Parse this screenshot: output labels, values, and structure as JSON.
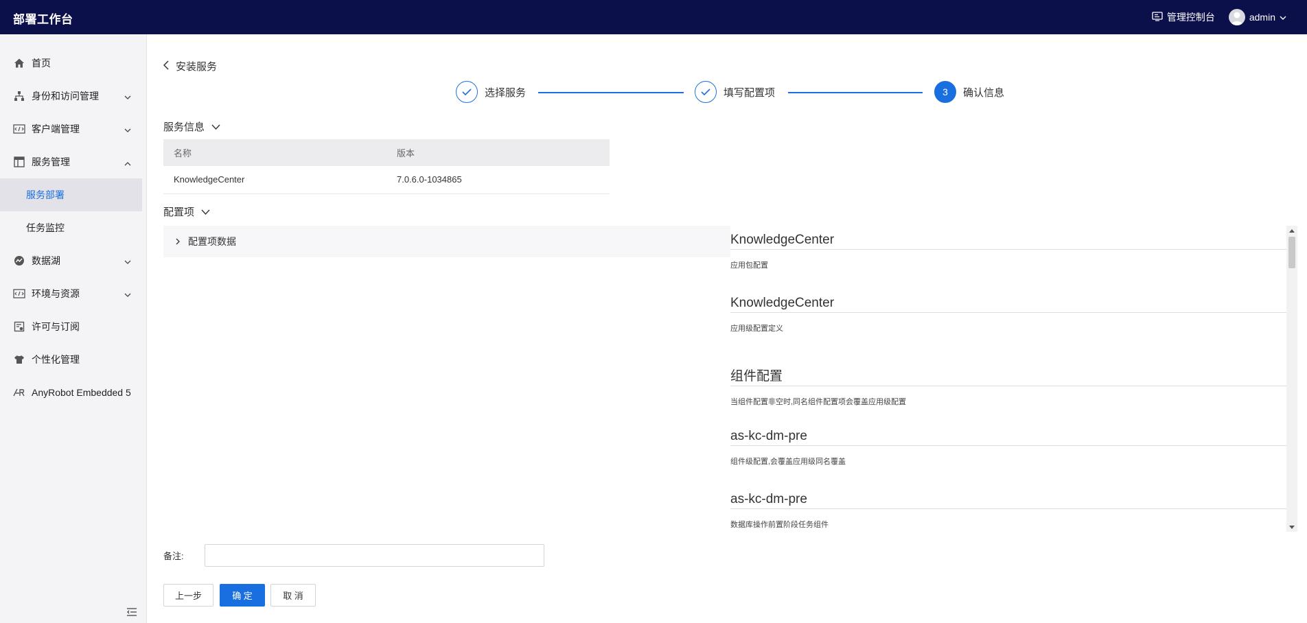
{
  "header": {
    "app_title": "部署工作台",
    "console_label": "管理控制台",
    "username": "admin"
  },
  "sidebar": {
    "items": [
      {
        "label": "首页",
        "icon": "home-icon"
      },
      {
        "label": "身份和访问管理",
        "icon": "org-tree-icon",
        "expanded": false
      },
      {
        "label": "客户端管理",
        "icon": "code-window-icon",
        "expanded": false
      },
      {
        "label": "服务管理",
        "icon": "table-icon",
        "expanded": true
      },
      {
        "label": "服务部署",
        "sub": true,
        "active": true
      },
      {
        "label": "任务监控",
        "sub": true
      },
      {
        "label": "数据湖",
        "icon": "data-lake-icon",
        "expanded": false
      },
      {
        "label": "环境与资源",
        "icon": "code-window-icon",
        "expanded": false
      },
      {
        "label": "许可与订阅",
        "icon": "license-icon"
      },
      {
        "label": "个性化管理",
        "icon": "shirt-icon"
      },
      {
        "label": "AnyRobot Embedded 5",
        "icon": "anyrobot-icon"
      }
    ]
  },
  "page": {
    "back_label": "安装服务",
    "steps": [
      {
        "label": "选择服务",
        "status": "done"
      },
      {
        "label": "填写配置项",
        "status": "done"
      },
      {
        "label": "确认信息",
        "status": "current",
        "number": "3"
      }
    ]
  },
  "service_info": {
    "title": "服务信息",
    "columns": [
      "名称",
      "版本"
    ],
    "rows": [
      [
        "KnowledgeCenter",
        "7.0.6.0-1034865"
      ]
    ]
  },
  "config": {
    "title": "配置项",
    "collapse_label": "配置项数据",
    "entries": [
      {
        "title": "KnowledgeCenter",
        "desc": "应用包配置"
      },
      {
        "title": "KnowledgeCenter",
        "desc": "应用级配置定义"
      },
      {
        "title": "组件配置",
        "desc": "当组件配置非空时,同名组件配置项会覆盖应用级配置"
      },
      {
        "title": "as-kc-dm-pre",
        "desc": "组件级配置,会覆盖应用级同名覆盖"
      },
      {
        "title": "as-kc-dm-pre",
        "desc": "数据库操作前置阶段任务组件"
      }
    ]
  },
  "form": {
    "remark_label": "备注:",
    "remark_value": ""
  },
  "buttons": {
    "prev": "上一步",
    "confirm": "确 定",
    "cancel": "取 消"
  },
  "colors": {
    "topbar": "#0b0f4a",
    "accent": "#1a6fe0",
    "sidebar_bg": "#f4f4f6"
  }
}
